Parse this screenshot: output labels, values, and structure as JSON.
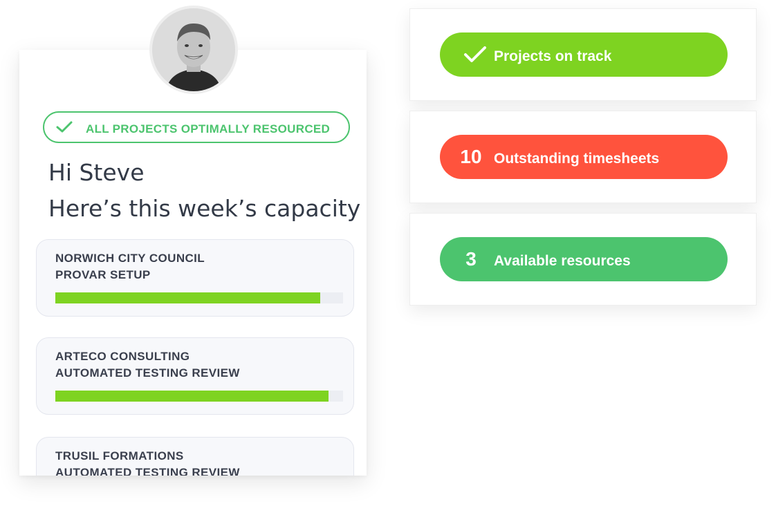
{
  "profile": {
    "avatar_icon": "user-avatar"
  },
  "status_banner": {
    "text": "ALL PROJECTS OPTIMALLY RESOURCED",
    "icon": "check-icon",
    "color": "#4cc46e"
  },
  "greeting": {
    "line1": "Hi Steve",
    "line2": "Here’s this week’s capacity"
  },
  "projects": [
    {
      "client": "NORWICH CITY COUNCIL",
      "project": "PROVAR SETUP",
      "progress": 0.92
    },
    {
      "client": "ARTECO CONSULTING",
      "project": "AUTOMATED TESTING REVIEW",
      "progress": 0.95
    },
    {
      "client": "TRUSIL FORMATIONS",
      "project": "AUTOMATED TESTING REVIEW",
      "progress": null
    }
  ],
  "stats": [
    {
      "value": "",
      "icon": "check-icon",
      "label": "Projects on track",
      "color": "#7ed321"
    },
    {
      "value": "10",
      "icon": "",
      "label": "Outstanding timesheets",
      "color": "#ff533d"
    },
    {
      "value": "3",
      "icon": "",
      "label": "Available resources",
      "color": "#4cc46e"
    }
  ],
  "colors": {
    "progress_fill": "#7ed321",
    "text": "#333a47"
  }
}
